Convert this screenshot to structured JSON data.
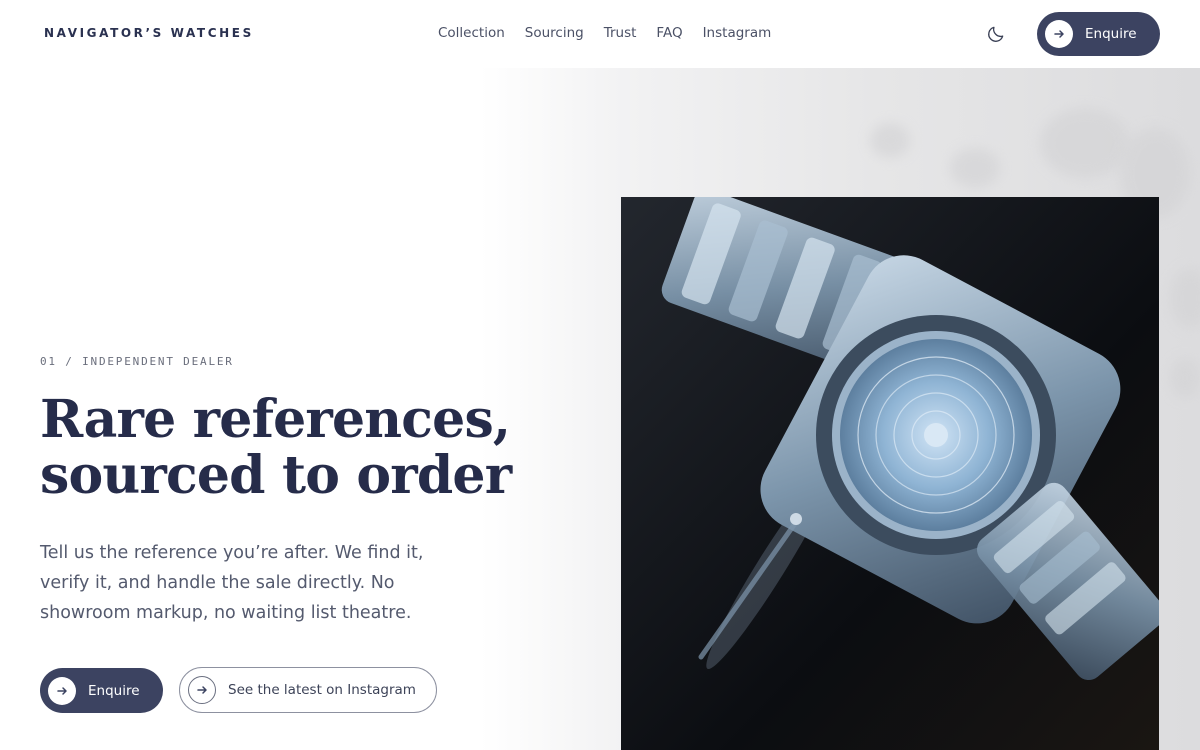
{
  "brand": {
    "logo": "NAVIGATOR’S WATCHES"
  },
  "nav": {
    "items": [
      "Collection",
      "Sourcing",
      "Trust",
      "FAQ",
      "Instagram"
    ]
  },
  "header": {
    "enquire_label": "Enquire",
    "theme_icon": "moon-icon"
  },
  "hero": {
    "kicker": "01 / INDEPENDENT DEALER",
    "headline_line1": "Rare references,",
    "headline_line2": "sourced to order",
    "intro": "Tell us the reference you’re after. We find it, verify it, and handle the sale directly. No showroom markup, no waiting list theatre.",
    "primary_cta": "Enquire",
    "secondary_cta": "See the latest on Instagram",
    "image_subject": "steel-wristwatch-caseback"
  },
  "colors": {
    "accent": "#3c4361",
    "heading": "#262c4a",
    "body_text": "#545a6e"
  }
}
